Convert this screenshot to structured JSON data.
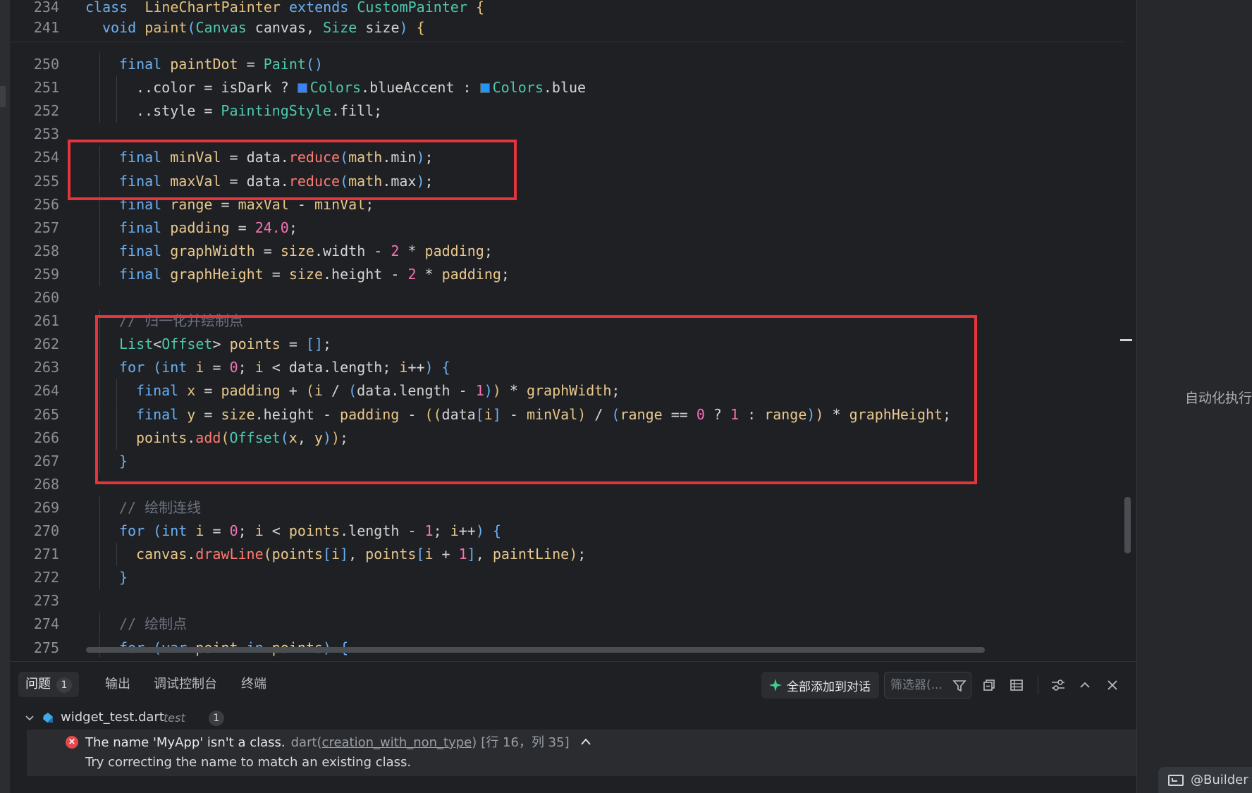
{
  "editor": {
    "sticky": [
      {
        "ln": "234",
        "indent": 0,
        "tokens": [
          [
            "kw",
            "class"
          ],
          [
            "",
            "  "
          ],
          [
            "fn",
            "LineChartPainter"
          ],
          [
            "",
            " "
          ],
          [
            "kw",
            "extends"
          ],
          [
            "",
            " "
          ],
          [
            "ty",
            "CustomPainter"
          ],
          [
            "",
            " "
          ],
          [
            "fn",
            "{"
          ]
        ]
      },
      {
        "ln": "241",
        "indent": 1,
        "tokens": [
          [
            "kw",
            "void"
          ],
          [
            "",
            " "
          ],
          [
            "fn",
            "paint"
          ],
          [
            "br",
            "("
          ],
          [
            "ty",
            "Canvas"
          ],
          [
            "",
            " canvas, "
          ],
          [
            "ty",
            "Size"
          ],
          [
            "",
            " size"
          ],
          [
            "br",
            ")"
          ],
          [
            "",
            " "
          ],
          [
            "fn",
            "{"
          ]
        ]
      }
    ],
    "lines": [
      {
        "ln": "250",
        "indent": 2,
        "tokens": [
          [
            "kw",
            "final"
          ],
          [
            "",
            " "
          ],
          [
            "var",
            "paintDot"
          ],
          [
            "",
            " = "
          ],
          [
            "ty",
            "Paint"
          ],
          [
            "br",
            "()"
          ]
        ]
      },
      {
        "ln": "251",
        "indent": 3,
        "tokens": [
          [
            "",
            "..color = isDark ? "
          ],
          [
            "sw",
            "#3b82f6"
          ],
          [
            "ty",
            "Colors"
          ],
          [
            "",
            ".blueAccent : "
          ],
          [
            "sw",
            "#2196f3"
          ],
          [
            "ty",
            "Colors"
          ],
          [
            "",
            ".blue"
          ]
        ]
      },
      {
        "ln": "252",
        "indent": 3,
        "tokens": [
          [
            "",
            "..style = "
          ],
          [
            "ty",
            "PaintingStyle"
          ],
          [
            "",
            ".fill;"
          ]
        ]
      },
      {
        "ln": "253",
        "indent": 0,
        "tokens": []
      },
      {
        "ln": "254",
        "indent": 2,
        "tokens": [
          [
            "kw",
            "final"
          ],
          [
            "",
            " "
          ],
          [
            "var",
            "minVal"
          ],
          [
            "",
            " = data."
          ],
          [
            "me",
            "reduce"
          ],
          [
            "br",
            "("
          ],
          [
            "var",
            "math"
          ],
          [
            "",
            ".min"
          ],
          [
            "br",
            ")"
          ],
          [
            ";",
            ";"
          ]
        ]
      },
      {
        "ln": "255",
        "indent": 2,
        "tokens": [
          [
            "kw",
            "final"
          ],
          [
            "",
            " "
          ],
          [
            "var",
            "maxVal"
          ],
          [
            "",
            " = data."
          ],
          [
            "me",
            "reduce"
          ],
          [
            "br",
            "("
          ],
          [
            "var",
            "math"
          ],
          [
            "",
            ".max"
          ],
          [
            "br",
            ")"
          ],
          [
            ";",
            ";"
          ]
        ]
      },
      {
        "ln": "256",
        "indent": 2,
        "tokens": [
          [
            "kw",
            "final"
          ],
          [
            "",
            " "
          ],
          [
            "var",
            "range"
          ],
          [
            "",
            " = "
          ],
          [
            "var",
            "maxVal"
          ],
          [
            "",
            " - "
          ],
          [
            "var",
            "minVal"
          ],
          [
            "",
            ";"
          ]
        ]
      },
      {
        "ln": "257",
        "indent": 2,
        "tokens": [
          [
            "kw",
            "final"
          ],
          [
            "",
            " "
          ],
          [
            "var",
            "padding"
          ],
          [
            "",
            " = "
          ],
          [
            "num",
            "24.0"
          ],
          [
            "",
            ";"
          ]
        ]
      },
      {
        "ln": "258",
        "indent": 2,
        "tokens": [
          [
            "kw",
            "final"
          ],
          [
            "",
            " "
          ],
          [
            "var",
            "graphWidth"
          ],
          [
            "",
            " = "
          ],
          [
            "var",
            "size"
          ],
          [
            "",
            ".width - "
          ],
          [
            "num",
            "2"
          ],
          [
            "",
            " * "
          ],
          [
            "var",
            "padding"
          ],
          [
            "",
            ";"
          ]
        ]
      },
      {
        "ln": "259",
        "indent": 2,
        "tokens": [
          [
            "kw",
            "final"
          ],
          [
            "",
            " "
          ],
          [
            "var",
            "graphHeight"
          ],
          [
            "",
            " = "
          ],
          [
            "var",
            "size"
          ],
          [
            "",
            ".height - "
          ],
          [
            "num",
            "2"
          ],
          [
            "",
            " * "
          ],
          [
            "var",
            "padding"
          ],
          [
            "",
            ";"
          ]
        ]
      },
      {
        "ln": "260",
        "indent": 0,
        "tokens": []
      },
      {
        "ln": "261",
        "indent": 2,
        "tokens": [
          [
            "cm",
            "// 归一化并绘制点"
          ]
        ]
      },
      {
        "ln": "262",
        "indent": 2,
        "tokens": [
          [
            "ty",
            "List"
          ],
          [
            "",
            "<"
          ],
          [
            "ty",
            "Offset"
          ],
          [
            "",
            "> "
          ],
          [
            "var",
            "points"
          ],
          [
            "",
            " = "
          ],
          [
            "br",
            "[]"
          ],
          [
            "",
            ";"
          ]
        ]
      },
      {
        "ln": "263",
        "indent": 2,
        "tokens": [
          [
            "kw",
            "for"
          ],
          [
            "",
            " "
          ],
          [
            "br",
            "("
          ],
          [
            "kw",
            "int"
          ],
          [
            "",
            " "
          ],
          [
            "var",
            "i"
          ],
          [
            "",
            " = "
          ],
          [
            "num",
            "0"
          ],
          [
            "",
            "; "
          ],
          [
            "var",
            "i"
          ],
          [
            "",
            " < data.length; "
          ],
          [
            "var",
            "i"
          ],
          [
            "",
            "++"
          ],
          [
            "br",
            ")"
          ],
          [
            "",
            " "
          ],
          [
            "br",
            "{"
          ]
        ]
      },
      {
        "ln": "264",
        "indent": 3,
        "tokens": [
          [
            "kw",
            "final"
          ],
          [
            "",
            " "
          ],
          [
            "var",
            "x"
          ],
          [
            "",
            " = "
          ],
          [
            "var",
            "padding"
          ],
          [
            "",
            " + "
          ],
          [
            "fn",
            "("
          ],
          [
            "var",
            "i"
          ],
          [
            "",
            " / "
          ],
          [
            "br",
            "("
          ],
          [
            "",
            "data.length - "
          ],
          [
            "num",
            "1"
          ],
          [
            "br",
            ")"
          ],
          [
            "fn",
            ")"
          ],
          [
            "",
            " * "
          ],
          [
            "var",
            "graphWidth"
          ],
          [
            "",
            ";"
          ]
        ]
      },
      {
        "ln": "265",
        "indent": 3,
        "tokens": [
          [
            "kw",
            "final"
          ],
          [
            "",
            " "
          ],
          [
            "var",
            "y"
          ],
          [
            "",
            " = "
          ],
          [
            "var",
            "size"
          ],
          [
            "",
            ".height - "
          ],
          [
            "var",
            "padding"
          ],
          [
            "",
            " - "
          ],
          [
            "fn",
            "(("
          ],
          [
            "",
            "data"
          ],
          [
            "br",
            "["
          ],
          [
            "var",
            "i"
          ],
          [
            "br",
            "]"
          ],
          [
            "",
            " - "
          ],
          [
            "var",
            "minVal"
          ],
          [
            "fn",
            ")"
          ],
          [
            "",
            " / "
          ],
          [
            "br",
            "("
          ],
          [
            "var",
            "range"
          ],
          [
            "",
            " == "
          ],
          [
            "num",
            "0"
          ],
          [
            "",
            " ? "
          ],
          [
            "num",
            "1"
          ],
          [
            "",
            " : "
          ],
          [
            "var",
            "range"
          ],
          [
            "br",
            ")"
          ],
          [
            "fn",
            ")"
          ],
          [
            "",
            " * "
          ],
          [
            "var",
            "graphHeight"
          ],
          [
            "",
            ";"
          ]
        ]
      },
      {
        "ln": "266",
        "indent": 3,
        "tokens": [
          [
            "var",
            "points"
          ],
          [
            "",
            "."
          ],
          [
            "me",
            "add"
          ],
          [
            "fn",
            "("
          ],
          [
            "ty",
            "Offset"
          ],
          [
            "br",
            "("
          ],
          [
            "var",
            "x"
          ],
          [
            "",
            ", "
          ],
          [
            "var",
            "y"
          ],
          [
            "br",
            ")"
          ],
          [
            "fn",
            ")"
          ],
          [
            "",
            ";"
          ]
        ]
      },
      {
        "ln": "267",
        "indent": 2,
        "tokens": [
          [
            "br",
            "}"
          ]
        ]
      },
      {
        "ln": "268",
        "indent": 0,
        "tokens": []
      },
      {
        "ln": "269",
        "indent": 2,
        "tokens": [
          [
            "cm",
            "// 绘制连线"
          ]
        ]
      },
      {
        "ln": "270",
        "indent": 2,
        "tokens": [
          [
            "kw",
            "for"
          ],
          [
            "",
            " "
          ],
          [
            "br",
            "("
          ],
          [
            "kw",
            "int"
          ],
          [
            "",
            " "
          ],
          [
            "var",
            "i"
          ],
          [
            "",
            " = "
          ],
          [
            "num",
            "0"
          ],
          [
            "",
            "; "
          ],
          [
            "var",
            "i"
          ],
          [
            "",
            " < "
          ],
          [
            "var",
            "points"
          ],
          [
            "",
            ".length - "
          ],
          [
            "num",
            "1"
          ],
          [
            "",
            "; "
          ],
          [
            "var",
            "i"
          ],
          [
            "",
            "++"
          ],
          [
            "br",
            ")"
          ],
          [
            "",
            " "
          ],
          [
            "br",
            "{"
          ]
        ]
      },
      {
        "ln": "271",
        "indent": 3,
        "tokens": [
          [
            "var",
            "canvas"
          ],
          [
            "",
            "."
          ],
          [
            "me",
            "drawLine"
          ],
          [
            "fn",
            "("
          ],
          [
            "var",
            "points"
          ],
          [
            "br",
            "["
          ],
          [
            "var",
            "i"
          ],
          [
            "br",
            "]"
          ],
          [
            "",
            ", "
          ],
          [
            "var",
            "points"
          ],
          [
            "br",
            "["
          ],
          [
            "var",
            "i"
          ],
          [
            "",
            " + "
          ],
          [
            "num",
            "1"
          ],
          [
            "br",
            "]"
          ],
          [
            "",
            ", "
          ],
          [
            "var",
            "paintLine"
          ],
          [
            "fn",
            ")"
          ],
          [
            "",
            ";"
          ]
        ]
      },
      {
        "ln": "272",
        "indent": 2,
        "tokens": [
          [
            "br",
            "}"
          ]
        ]
      },
      {
        "ln": "273",
        "indent": 0,
        "tokens": []
      },
      {
        "ln": "274",
        "indent": 2,
        "tokens": [
          [
            "cm",
            "// 绘制点"
          ]
        ]
      },
      {
        "ln": "275",
        "indent": 2,
        "tokens": [
          [
            "kw",
            "for"
          ],
          [
            "",
            " "
          ],
          [
            "br",
            "("
          ],
          [
            "kw",
            "var"
          ],
          [
            "",
            " "
          ],
          [
            "var",
            "point"
          ],
          [
            "",
            " "
          ],
          [
            "kw",
            "in"
          ],
          [
            "",
            " "
          ],
          [
            "var",
            "points"
          ],
          [
            "br",
            ")"
          ],
          [
            "",
            " "
          ],
          [
            "br",
            "{"
          ]
        ]
      }
    ]
  },
  "right_pane": {
    "label": "自动化执行",
    "builder": "@Builder"
  },
  "panel": {
    "tabs": [
      {
        "label": "问题",
        "badge": "1",
        "active": true
      },
      {
        "label": "输出"
      },
      {
        "label": "调试控制台"
      },
      {
        "label": "终端"
      }
    ],
    "add_all_label": "全部添加到对话",
    "filter_placeholder": "筛选器(...",
    "file": {
      "name": "widget_test.dart",
      "dir": "test",
      "count": "1"
    },
    "problem": {
      "message": "The name 'MyApp' isn't a class.",
      "source": "dart(",
      "code": "creation_with_non_type",
      "source_end": ")",
      "position": "[行 16，列 35]",
      "hint": "Try correcting the name to match an existing class."
    }
  },
  "colors": {
    "highlight": "#e5343c",
    "accent": "#6ab0f3",
    "error": "#e5484d"
  }
}
